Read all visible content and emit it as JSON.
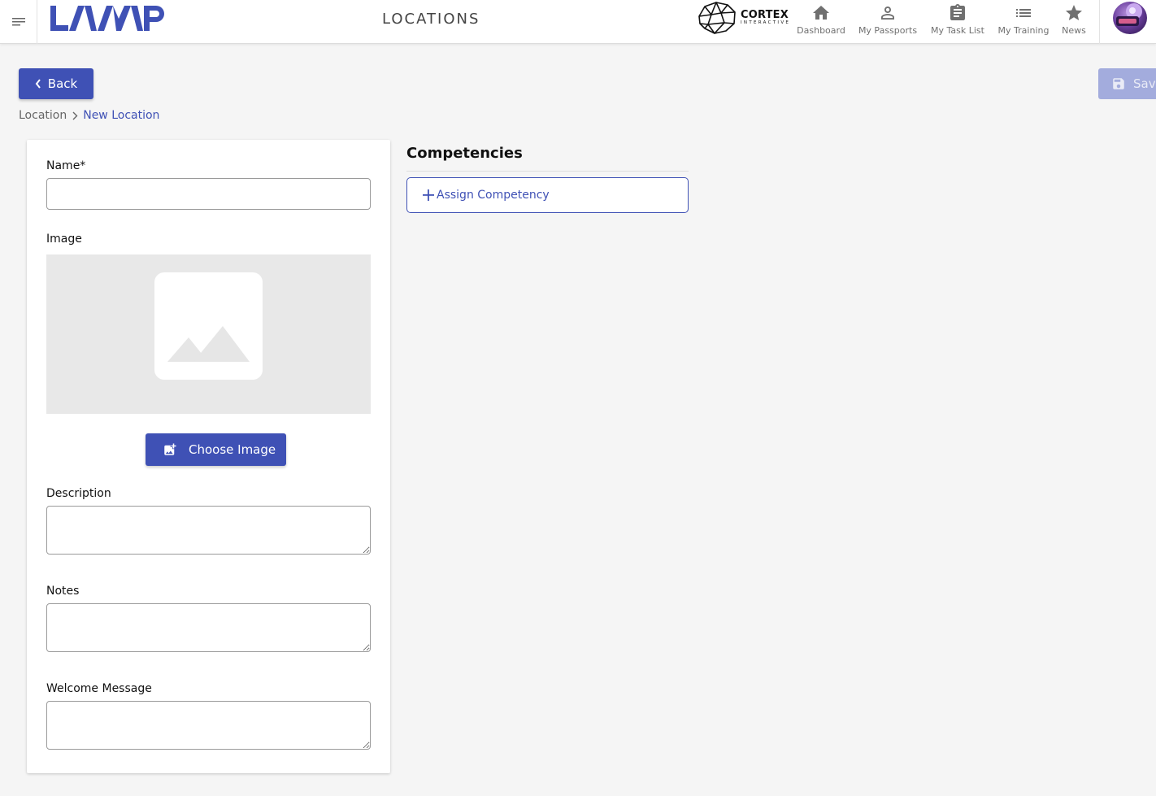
{
  "header": {
    "logo_text": "LAMP",
    "page_title": "LOCATIONS",
    "partner_logo": {
      "name": "CORTEX",
      "tagline": "INTERACTIVE"
    },
    "nav": [
      {
        "label": "Dashboard",
        "icon": "home-icon"
      },
      {
        "label": "My Passports",
        "icon": "person-icon"
      },
      {
        "label": "My Task List",
        "icon": "clipboard-icon"
      },
      {
        "label": "My Training",
        "icon": "list-icon"
      },
      {
        "label": "News",
        "icon": "star-icon"
      }
    ],
    "avatar_icon": "user-avatar"
  },
  "toolbar": {
    "back_label": "Back",
    "save_label": "Save"
  },
  "breadcrumb": {
    "items": [
      "Location",
      "New Location"
    ]
  },
  "form": {
    "name_label": "Name*",
    "name_value": "",
    "image_label": "Image",
    "choose_image_label": "Choose Image",
    "description_label": "Description",
    "description_value": "",
    "notes_label": "Notes",
    "notes_value": "",
    "welcome_label": "Welcome Message",
    "welcome_value": ""
  },
  "competencies": {
    "title": "Competencies",
    "assign_label": "Assign Competency"
  },
  "colors": {
    "primary": "#3f51b5",
    "primary_disabled": "#a3acdd",
    "background": "#f5f5f5",
    "image_placeholder": "#e8e8e8"
  }
}
